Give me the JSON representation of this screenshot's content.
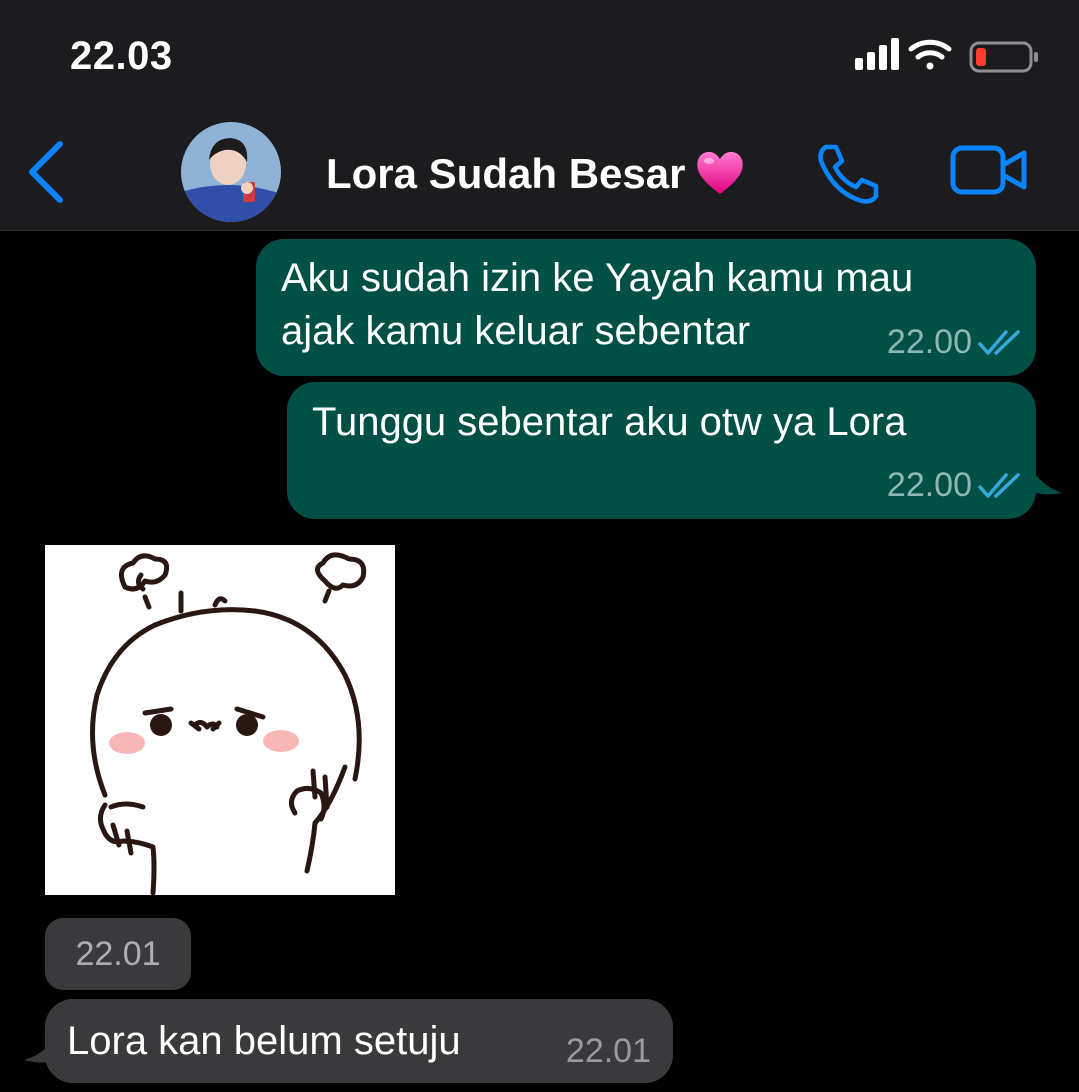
{
  "status_bar": {
    "time": "22.03",
    "icons": [
      "signal-icon",
      "wifi-icon",
      "battery-low-icon"
    ]
  },
  "header": {
    "back_icon": "chevron-left-icon",
    "contact_name": "Lora Sudah Besar",
    "name_emoji_icon": "pink-heart-icon",
    "call_icon": "phone-icon",
    "video_icon": "video-camera-icon",
    "accent_color": "#0a84ff"
  },
  "messages": [
    {
      "direction": "outgoing",
      "lines": [
        "Aku sudah izin ke Yayah kamu mau",
        "ajak kamu keluar sebentar"
      ],
      "time": "22.00",
      "status": "read"
    },
    {
      "direction": "outgoing",
      "lines": [
        "Tunggu sebentar aku otw ya Lora"
      ],
      "time": "22.00",
      "status": "read"
    },
    {
      "direction": "incoming",
      "type": "sticker",
      "sticker_icon": "angry-bun-sticker",
      "time": "22.01"
    },
    {
      "direction": "incoming",
      "lines": [
        "Lora kan belum setuju"
      ],
      "time": "22.01"
    }
  ],
  "colors": {
    "outgoing_bubble": "#005046",
    "incoming_bubble": "#3a3a3c",
    "read_ticks": "#34aadc",
    "background": "#000000"
  }
}
